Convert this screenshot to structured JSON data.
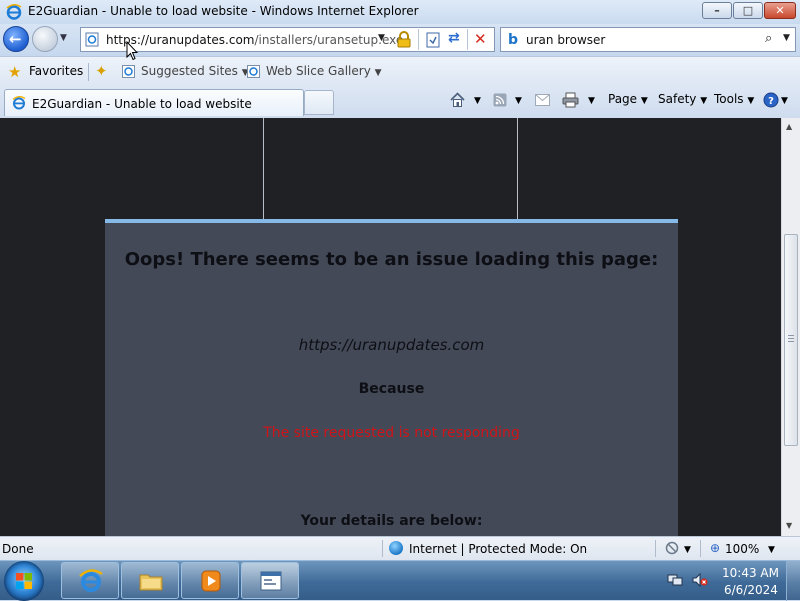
{
  "window": {
    "title": "E2Guardian - Unable to load website - Windows Internet Explorer",
    "controls": {
      "minimize": "–",
      "maximize": "□",
      "close": "✕"
    }
  },
  "navigation": {
    "address_prefix": "https://",
    "address_host": "uranupdates.com",
    "address_path": "/installers/uransetup.exe",
    "search_query": "uran browser",
    "back_icon": "back-arrow-icon",
    "forward_icon": "forward-arrow-icon"
  },
  "favorites_bar": {
    "favorites_label": "Favorites",
    "suggested_sites_label": "Suggested Sites",
    "web_slice_gallery_label": "Web Slice Gallery"
  },
  "tabs": {
    "active_label": "E2Guardian - Unable to load website"
  },
  "command_bar": {
    "page_label": "Page",
    "safety_label": "Safety",
    "tools_label": "Tools"
  },
  "page": {
    "heading": "Oops! There seems to be an issue loading this page:",
    "site_url": "https://uranupdates.com",
    "because_label": "Because",
    "reason": "The site requested is not responding",
    "details_heading": "Your details are below:",
    "reason_color": "#d01418",
    "card_color": "#444958",
    "card_accent_color": "#84b9e8"
  },
  "status_bar": {
    "status": "Done",
    "zone": "Internet | Protected Mode: On",
    "zoom": "100%"
  },
  "taskbar": {
    "time": "10:43 AM",
    "date": "6/6/2024"
  }
}
